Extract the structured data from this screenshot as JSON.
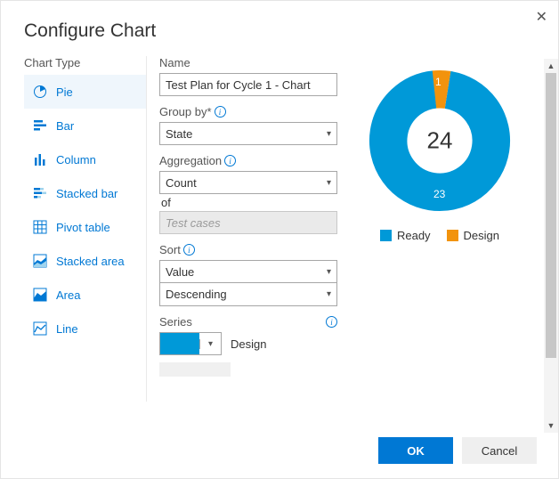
{
  "dialog": {
    "title": "Configure Chart"
  },
  "chartTypes": {
    "label": "Chart Type",
    "items": [
      {
        "label": "Pie"
      },
      {
        "label": "Bar"
      },
      {
        "label": "Column"
      },
      {
        "label": "Stacked bar"
      },
      {
        "label": "Pivot table"
      },
      {
        "label": "Stacked area"
      },
      {
        "label": "Area"
      },
      {
        "label": "Line"
      }
    ]
  },
  "form": {
    "name_label": "Name",
    "name_value": "Test Plan for Cycle 1 - Chart",
    "group_by_label": "Group by*",
    "group_by_value": "State",
    "aggregation_label": "Aggregation",
    "aggregation_value": "Count",
    "of_label": "of",
    "of_value": "Test cases",
    "sort_label": "Sort",
    "sort_value_field": "Value",
    "sort_value_dir": "Descending",
    "series_label": "Series",
    "series_selected_name": "Design"
  },
  "legend": {
    "items": [
      {
        "label": "Ready",
        "color": "#0099d8"
      },
      {
        "label": "Design",
        "color": "#f2930d"
      }
    ]
  },
  "footer": {
    "ok": "OK",
    "cancel": "Cancel"
  },
  "chart_data": {
    "type": "pie",
    "subtype": "donut",
    "categories": [
      "Ready",
      "Design"
    ],
    "values": [
      23,
      1
    ],
    "total": 24,
    "colors": [
      "#0099d8",
      "#f2930d"
    ],
    "data_labels": [
      "23",
      "1"
    ],
    "center_label": "24",
    "legend_position": "bottom"
  }
}
